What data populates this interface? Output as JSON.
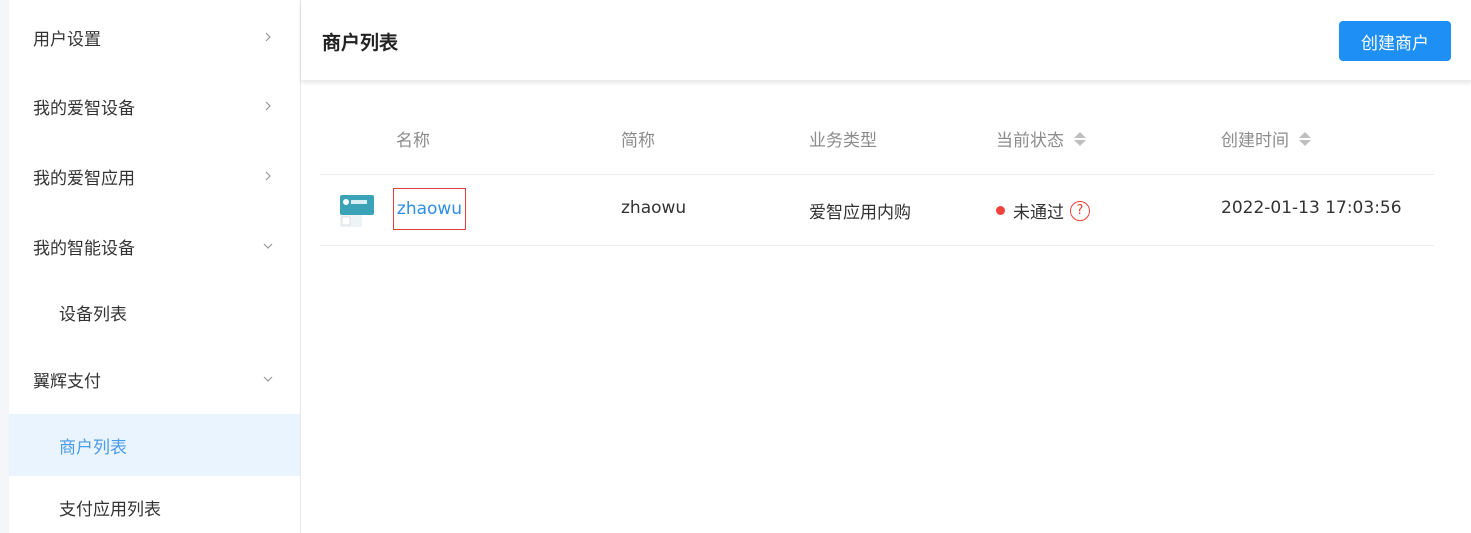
{
  "sidebar": {
    "items": [
      {
        "label": "用户设置",
        "expanded": false
      },
      {
        "label": "我的爱智设备",
        "expanded": false
      },
      {
        "label": "我的爱智应用",
        "expanded": false
      },
      {
        "label": "我的智能设备",
        "expanded": true
      },
      {
        "label": "设备列表"
      },
      {
        "label": "翼辉支付",
        "expanded": true
      },
      {
        "label": "商户列表",
        "active": true
      },
      {
        "label": "支付应用列表"
      }
    ]
  },
  "header": {
    "title": "商户列表",
    "create_button": "创建商户"
  },
  "table": {
    "columns": [
      "名称",
      "简称",
      "业务类型",
      "当前状态",
      "创建时间"
    ],
    "rows": [
      {
        "name": "zhaowu",
        "short_name": "zhaowu",
        "business_type": "爱智应用内购",
        "status": "未通过",
        "created_at": "2022-01-13 17:03:56"
      }
    ]
  },
  "colors": {
    "accent": "#1e90f5",
    "active_bg": "#eaf4fe",
    "status_failed": "#f0413a",
    "highlight_border": "#e0403a"
  }
}
